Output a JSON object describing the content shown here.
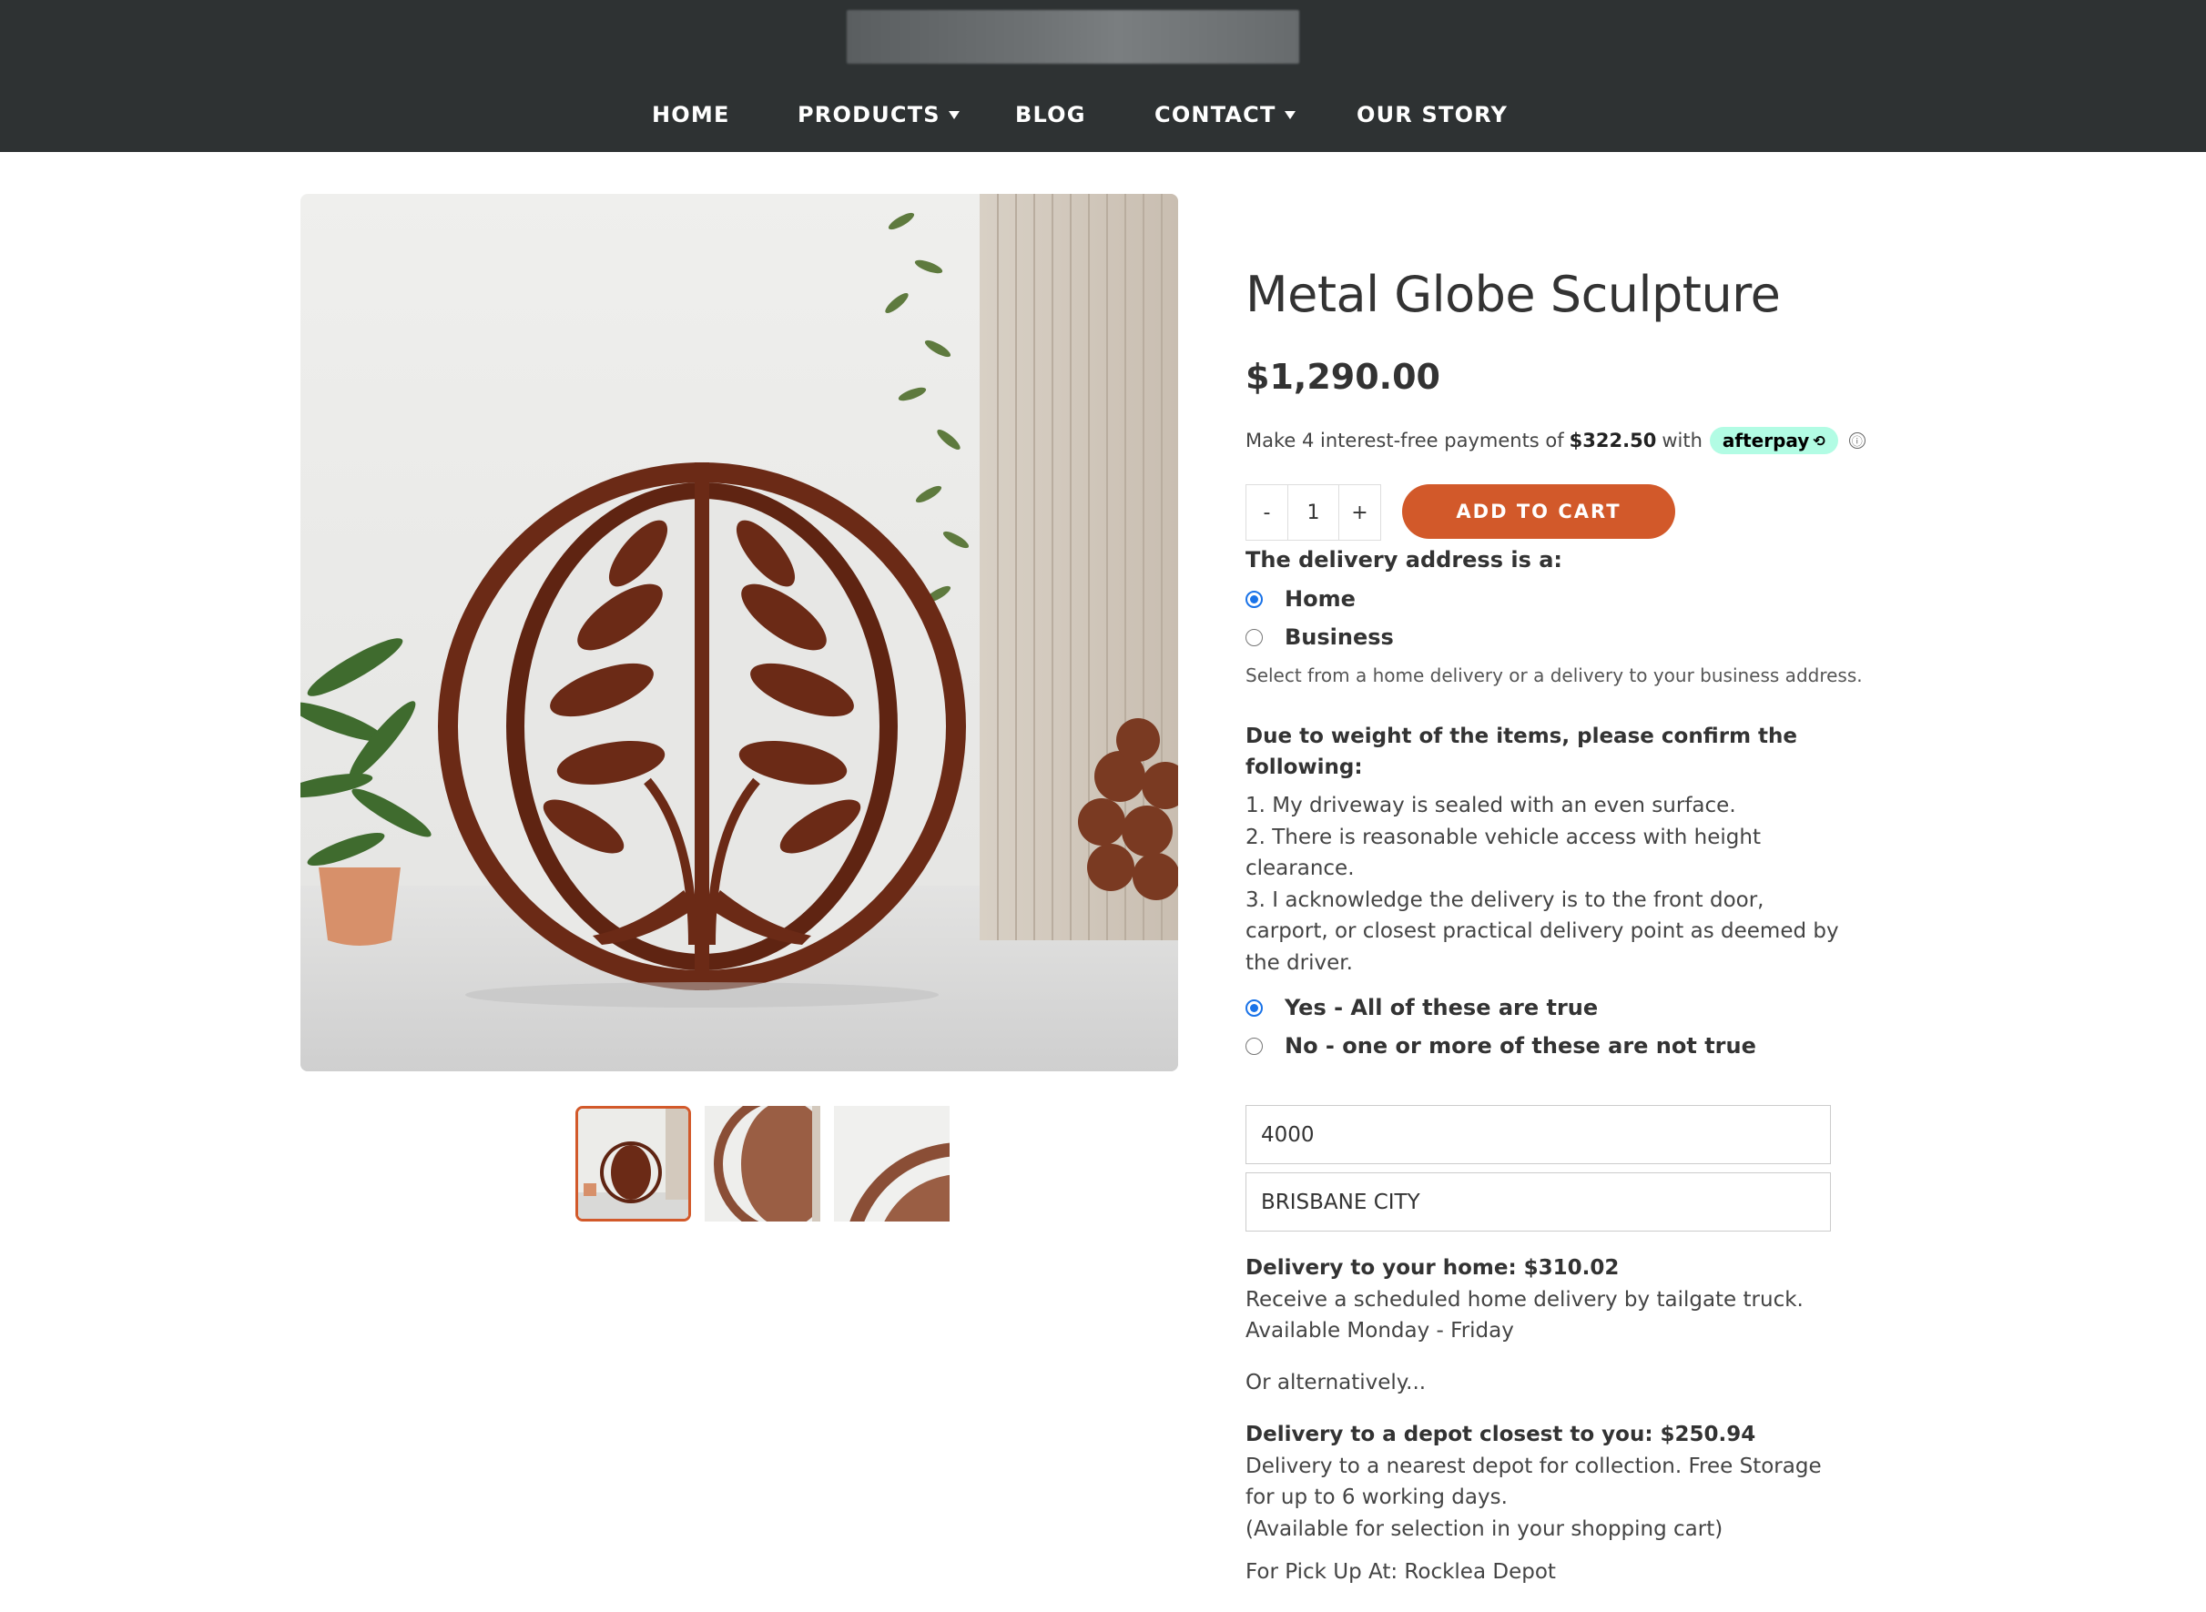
{
  "header": {
    "nav": [
      {
        "label": "HOME",
        "has_dropdown": false
      },
      {
        "label": "PRODUCTS",
        "has_dropdown": true
      },
      {
        "label": "BLOG",
        "has_dropdown": false
      },
      {
        "label": "CONTACT",
        "has_dropdown": true
      },
      {
        "label": "OUR STORY",
        "has_dropdown": false
      }
    ]
  },
  "product": {
    "title": "Metal Globe Sculpture",
    "price": "$1,290.00",
    "afterpay": {
      "prefix": "Make 4 interest-free payments of",
      "amount": "$322.50",
      "suffix": "with",
      "brand": "afterpay",
      "info_icon": "ⓘ"
    },
    "quantity": {
      "minus": "-",
      "value": "1",
      "plus": "+"
    },
    "add_to_cart": "ADD TO CART",
    "thumbnails_count": 3,
    "active_thumbnail": 1
  },
  "delivery": {
    "question": "The delivery address is a:",
    "options": [
      {
        "label": "Home",
        "checked": true
      },
      {
        "label": "Business",
        "checked": false
      }
    ],
    "note": "Select from a home delivery or a delivery to your business address."
  },
  "confirm": {
    "heading": "Due to weight of the items, please confirm the following:",
    "items": [
      "1. My driveway is sealed with an even surface.",
      "2. There is reasonable vehicle access with height clearance.",
      "3. I acknowledge the delivery is to the front door, carport, or closest practical delivery point as deemed by the driver."
    ],
    "options": [
      {
        "label": "Yes - All of these are true",
        "checked": true
      },
      {
        "label": "No - one or more of these are not true",
        "checked": false
      }
    ]
  },
  "location": {
    "postcode": "4000",
    "suburb": "BRISBANE CITY"
  },
  "shipping": {
    "home_title": "Delivery to your home: $310.02",
    "home_line1": "Receive a scheduled home delivery by tailgate truck.",
    "home_line2": "Available Monday - Friday",
    "alternative": "Or alternatively...",
    "depot_title": "Delivery to a depot closest to you: $250.94",
    "depot_line1": "Delivery to a nearest depot for collection. Free Storage for up to 6 working days.",
    "depot_line2": "(Available for selection in your shopping cart)",
    "pickup": "For Pick Up At: Rocklea Depot"
  },
  "colors": {
    "header_bg": "#2e3233",
    "accent": "#d2592a",
    "afterpay_badge": "#b2fce4",
    "radio_checked": "#1a73e8"
  }
}
